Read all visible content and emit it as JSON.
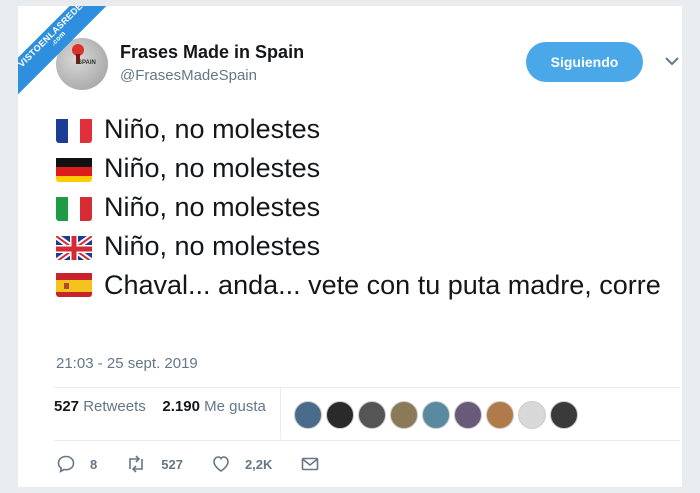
{
  "watermark": {
    "line1": "VISTOENLASREDES",
    "line2": ".com"
  },
  "user": {
    "display_name": "Frases Made in Spain",
    "handle": "@FrasesMadeSpain",
    "avatar_label": "SPAIN"
  },
  "follow_button": {
    "label": "Siguiendo"
  },
  "tweet": {
    "lines": [
      {
        "flag": "france-flag-icon",
        "text": "Niño, no molestes"
      },
      {
        "flag": "germany-flag-icon",
        "text": "Niño, no molestes"
      },
      {
        "flag": "italy-flag-icon",
        "text": "Niño, no molestes"
      },
      {
        "flag": "uk-flag-icon",
        "text": "Niño, no molestes"
      },
      {
        "flag": "spain-flag-icon",
        "text": "Chaval... anda... vete con tu puta madre, corre"
      }
    ],
    "timestamp": "21:03 - 25 sept. 2019"
  },
  "stats": {
    "retweets_count": "527",
    "retweets_label": "Retweets",
    "likes_count": "2.190",
    "likes_label": "Me gusta"
  },
  "actions": {
    "replies": "8",
    "retweets": "527",
    "likes": "2,2K"
  },
  "colors": {
    "accent": "#4aa8e8",
    "muted": "#657786",
    "text": "#14171a"
  }
}
